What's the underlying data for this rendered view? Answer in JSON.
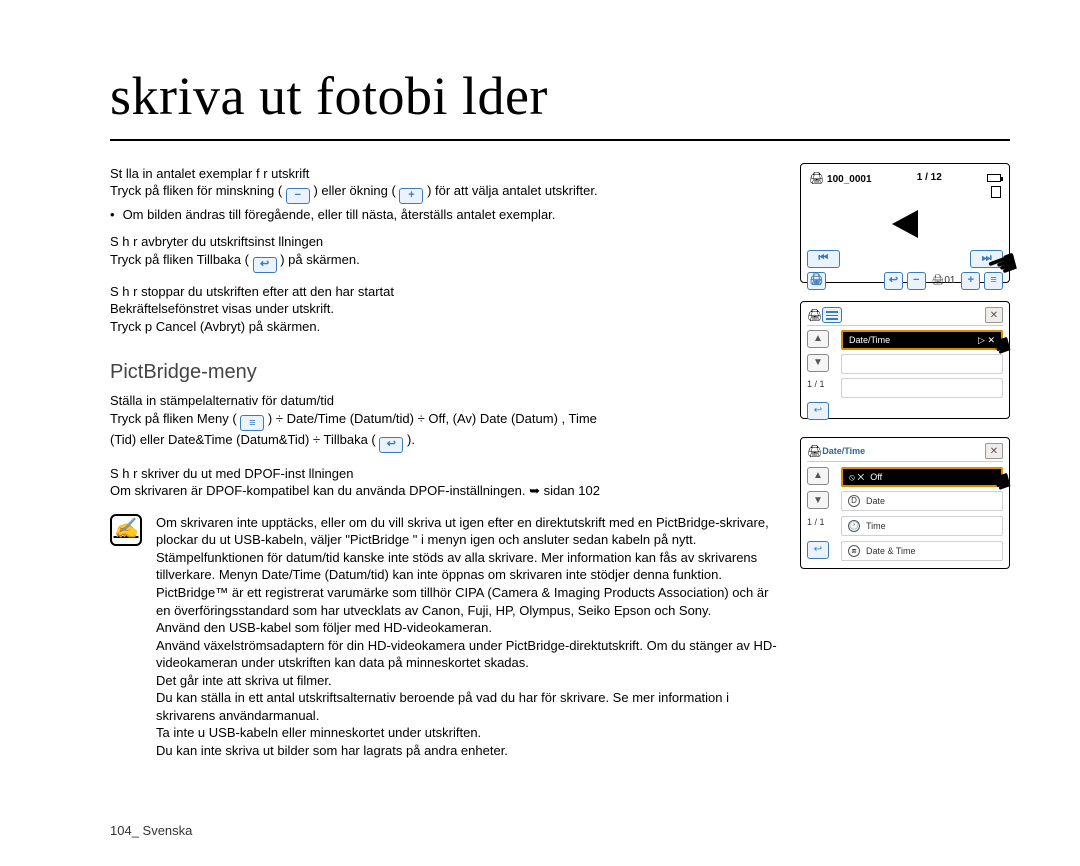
{
  "title": "skriva ut fotobi  lder",
  "steps": {
    "s1": {
      "head": "St  lla in antalet exemplar f  r utskrift",
      "p1a": "Tryck på fliken för minskning (",
      "p1b": ") eller ökning (",
      "p1c": ") för att välja antalet utskrifter.",
      "bullet": "Om bilden ändras till föregående, eller till nästa, återställs antalet exemplar."
    },
    "s2": {
      "head": "S  h  r avbryter du utskriftsinst  llningen",
      "p1a": "Tryck på fliken Tillbaka (",
      "p1b": ") på skärmen."
    },
    "s3": {
      "head": "S  h  r stoppar du utskriften efter att den har startat",
      "p1": "Bekräftelsefönstret visas under utskrift.",
      "p2": "Tryck p   Cancel (Avbryt)     på skärmen."
    }
  },
  "pict": {
    "heading": "PictBridge-meny",
    "sub": "Ställa in stämpelalternativ för datum/tid",
    "line_a": "Tryck på fliken Meny (",
    "line_b": ") ÷  Date/Time (Datum/tid)    ÷   Off, (Av)  Date (Datum)    , Time",
    "line_c": "(Tid) eller  Date&Time (Datum&Tid)     ÷  Tillbaka (",
    "line_d": ").",
    "dpof_head": "S  h  r skriver du ut med DPOF-inst  llningen",
    "dpof_body": "Om skrivaren är DPOF-kompatibel kan du använda DPOF-inställningen. ➥ sidan 102"
  },
  "note": {
    "i1": "Om skrivaren inte upptäcks, eller om du vill skriva ut igen efter en direktutskrift med en PictBridge-skrivare, plockar du ut USB-kabeln, väljer \"PictBridge \" i menyn igen och ansluter sedan kabeln på nytt.",
    "i2": "Stämpelfunktionen för datum/tid kanske inte stöds av alla skrivare. Mer information kan fås av skrivarens tillverkare. Menyn  Date/Time (Datum/tid)     kan inte öppnas om skrivaren inte stödjer denna funktion.",
    "i3": "PictBridge™ är ett registrerat varumärke som tillhör CIPA (Camera & Imaging Products Association) och är en överföringsstandard som har utvecklats av Canon, Fuji, HP, Olympus, Seiko Epson och Sony.",
    "i4": "Använd den USB-kabel som följer med HD-videokameran.",
    "i5": "Använd växelströmsadaptern för din HD-videokamera under PictBridge-direktutskrift. Om du stänger av HD-videokameran under utskriften kan data på minneskortet skadas.",
    "i6": "Det går inte att skriva ut filmer.",
    "i7": "Du kan ställa in ett antal utskriftsalternativ beroende på vad du har för skrivare. Se mer information i skrivarens användarmanual.",
    "i8": "Ta inte u USB-kabeln eller minneskortet under utskriften.",
    "i9": "Du kan inte skriva ut bilder som har lagrats på andra enheter."
  },
  "panel1": {
    "folder": "100_0001",
    "counter": "1 / 12",
    "copies": "01"
  },
  "panel2": {
    "selected": "Date/Time",
    "page": "1 / 1",
    "play_hint": "▷ ✕"
  },
  "panel3": {
    "title": "Date/Time",
    "page": "1 / 1",
    "opts": {
      "o1": "Off",
      "o2": "Date",
      "o3": "Time",
      "o4": "Date & Time"
    }
  },
  "footer": "104_ Svenska",
  "icons": {
    "minus": "−",
    "plus": "+",
    "back": "↩",
    "menu": "≡",
    "print": "🖨",
    "prev": "⏮",
    "next": "⏭",
    "up": "▲",
    "down": "▼"
  }
}
